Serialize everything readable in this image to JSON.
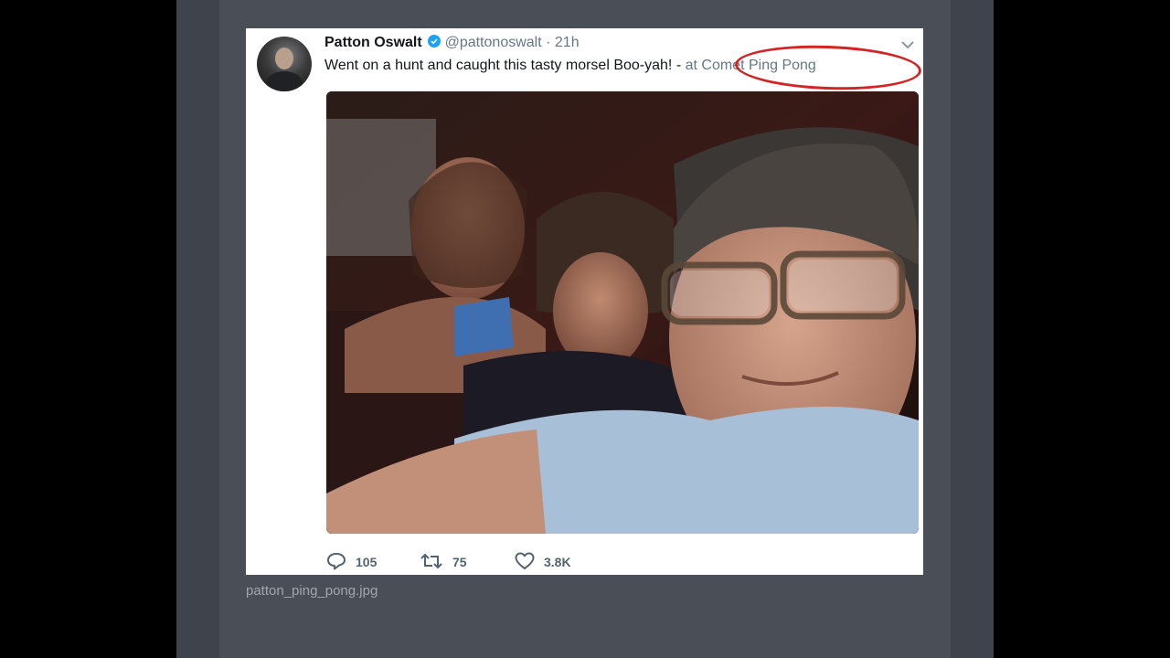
{
  "tweet": {
    "name": "Patton Oswalt",
    "handle": "@pattonoswalt",
    "separator": "·",
    "time": "21h",
    "text": "Went on a hunt and caught this tasty morsel  Boo-yah!",
    "dash": "-",
    "location": "at Comet Ping Pong",
    "replies": "105",
    "retweets": "75",
    "likes": "3.8K",
    "icons": {
      "verified": "verified-badge-icon",
      "menu": "chevron-down-icon",
      "reply": "reply-icon",
      "retweet": "retweet-icon",
      "like": "heart-icon"
    }
  },
  "annotation": {
    "color": "#d32424"
  },
  "caption": "patton_ping_pong.jpg",
  "colors": {
    "link_blue": "#1da1f2",
    "muted": "#657786"
  }
}
